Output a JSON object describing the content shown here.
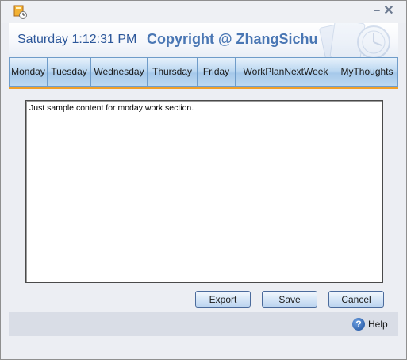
{
  "window": {
    "icons": {
      "app": "app-icon",
      "minimize": "minimize-icon",
      "close": "close-icon"
    },
    "minimize_glyph": "−",
    "close_glyph": "✕"
  },
  "banner": {
    "clock": "Saturday 1:12:31 PM",
    "copyright": "Copyright @ ZhangSichu"
  },
  "tabs": [
    {
      "label": "Monday",
      "selected": true
    },
    {
      "label": "Tuesday"
    },
    {
      "label": "Wednesday"
    },
    {
      "label": "Thursday"
    },
    {
      "label": "Friday"
    },
    {
      "label": "WorkPlanNextWeek"
    },
    {
      "label": "MyThoughts"
    }
  ],
  "editor": {
    "content": "Just sample content for moday work section."
  },
  "buttons": {
    "export": "Export",
    "save": "Save",
    "cancel": "Cancel"
  },
  "footer": {
    "help_label": "Help",
    "help_glyph": "?",
    "help_icon": "help-icon"
  },
  "colors": {
    "tab_gradient": "#bcd8f1",
    "accent_line": "#f0a02a",
    "title_text": "#2c579a"
  }
}
